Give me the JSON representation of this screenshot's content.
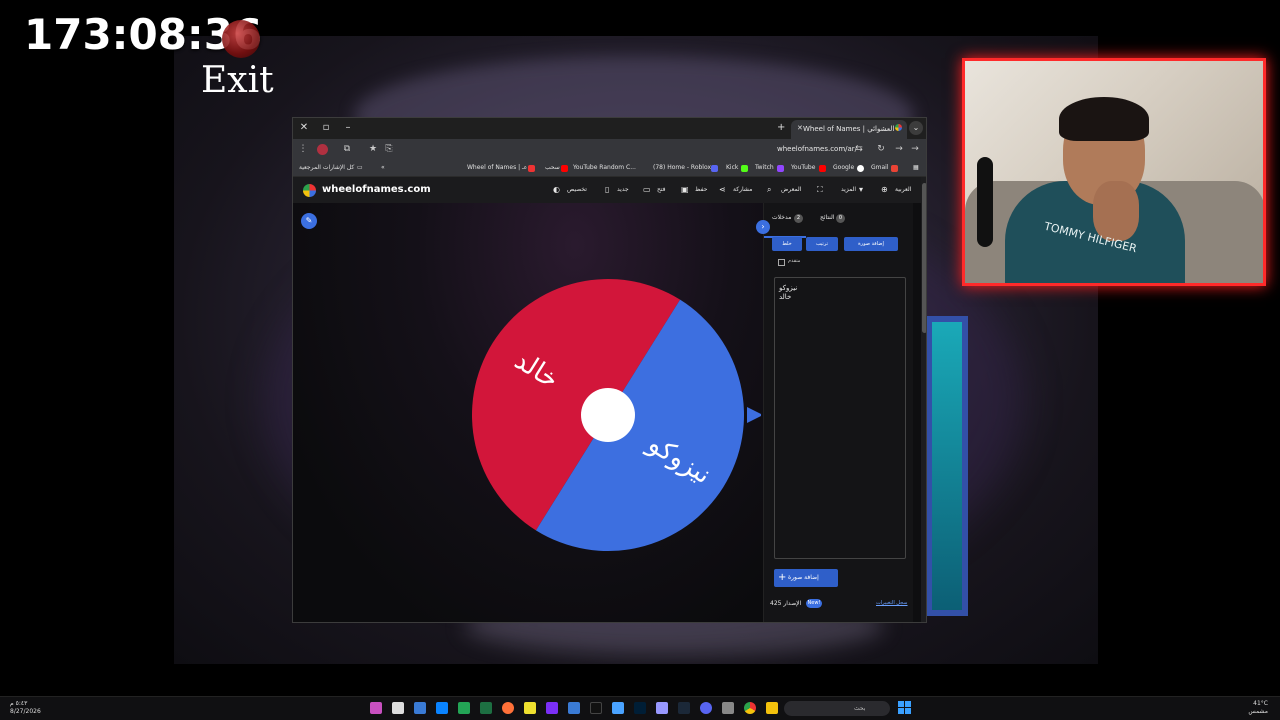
{
  "overlay": {
    "timer": "173:08:36",
    "exit": "Exit"
  },
  "webcam": {
    "shirt_brand": "TOMMY HILFIGER"
  },
  "browser": {
    "tab_title": "Wheel of Names | العشوائي",
    "url": "wheelofnames.com/ar/",
    "bookmarks": [
      "Wheel of Names | عـ...",
      "سحب",
      "YouTube Random C...",
      "(78) Home - Roblox",
      "Kick",
      "Twitch",
      "YouTube",
      "Google",
      "Gmail"
    ],
    "bookmarks_folder": "كل الإشارات المرجعية"
  },
  "site": {
    "title": "wheelofnames.com",
    "nav": {
      "customize": "تخصيص",
      "new": "جديد",
      "open": "فتح",
      "save": "حفظ",
      "share": "مشاركة",
      "gallery": "المعرض",
      "more": "المزيد",
      "language": "العربية"
    }
  },
  "wheel": {
    "slices": [
      {
        "label": "خالد",
        "color": "#d2163a"
      },
      {
        "label": "نيزوكو",
        "color": "#3d6fe0"
      }
    ]
  },
  "panel": {
    "tab_entries": "مدخلات",
    "tab_entries_count": "2",
    "tab_results": "النتائج",
    "tab_results_count": "0",
    "shuffle": "خلط",
    "sort": "ترتيب",
    "add_image": "إضافة صورة",
    "advanced": "متقدم",
    "entries": [
      "نيزوكو",
      "خالد"
    ],
    "add_entry": "إضافة صورة",
    "version": "الإصدار 425",
    "new_badge": "New!",
    "changelog": "سجل التغييرات"
  },
  "taskbar": {
    "time": "٥:٤٣ م",
    "date": "8/27/2026",
    "search": "بحث",
    "weather_temp": "41°C",
    "weather_label": "مشمس"
  }
}
